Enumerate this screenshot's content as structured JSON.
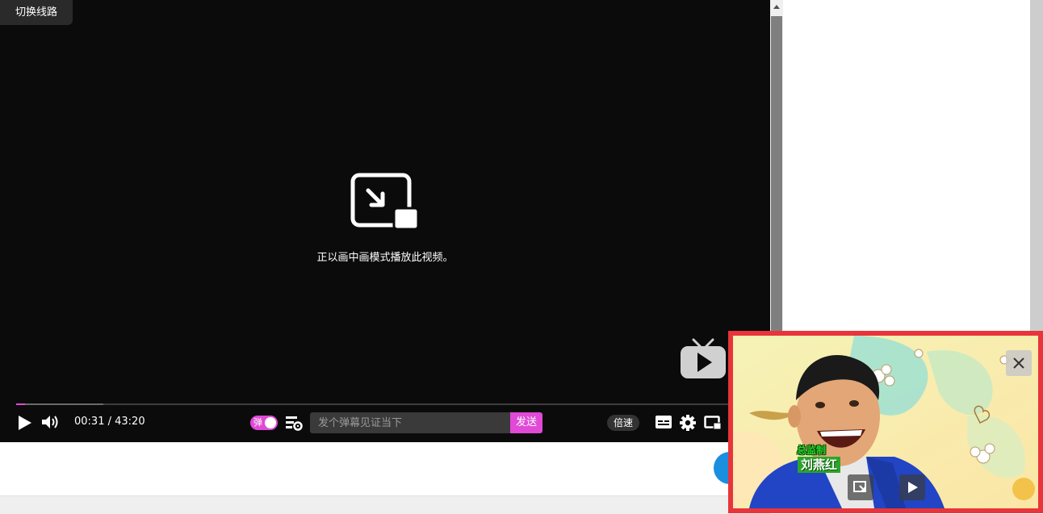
{
  "player": {
    "route_switch_label": "切换线路",
    "pip_message": "正以画中画模式播放此视频。",
    "current_time": "00:31",
    "time_separator": " / ",
    "duration": "43:20",
    "played_fraction": 0.012,
    "buffered_fraction": 0.116,
    "danmaku_toggle_label": "弹",
    "danmaku_enabled": true,
    "danmaku_input_placeholder": "发个弹幕见证当下",
    "danmaku_send_label": "发送",
    "speed_label": "倍速",
    "accent_color": "#e04ad6"
  },
  "pip_window": {
    "caption_role": "总监制",
    "caption_name": "刘燕红",
    "border_color": "#e8343a"
  },
  "icons": [
    "play-icon",
    "volume-icon",
    "danmaku-settings-icon",
    "subtitle-icon",
    "settings-icon",
    "pip-icon",
    "close-icon",
    "back-to-tab-icon",
    "tv-logo-icon"
  ]
}
